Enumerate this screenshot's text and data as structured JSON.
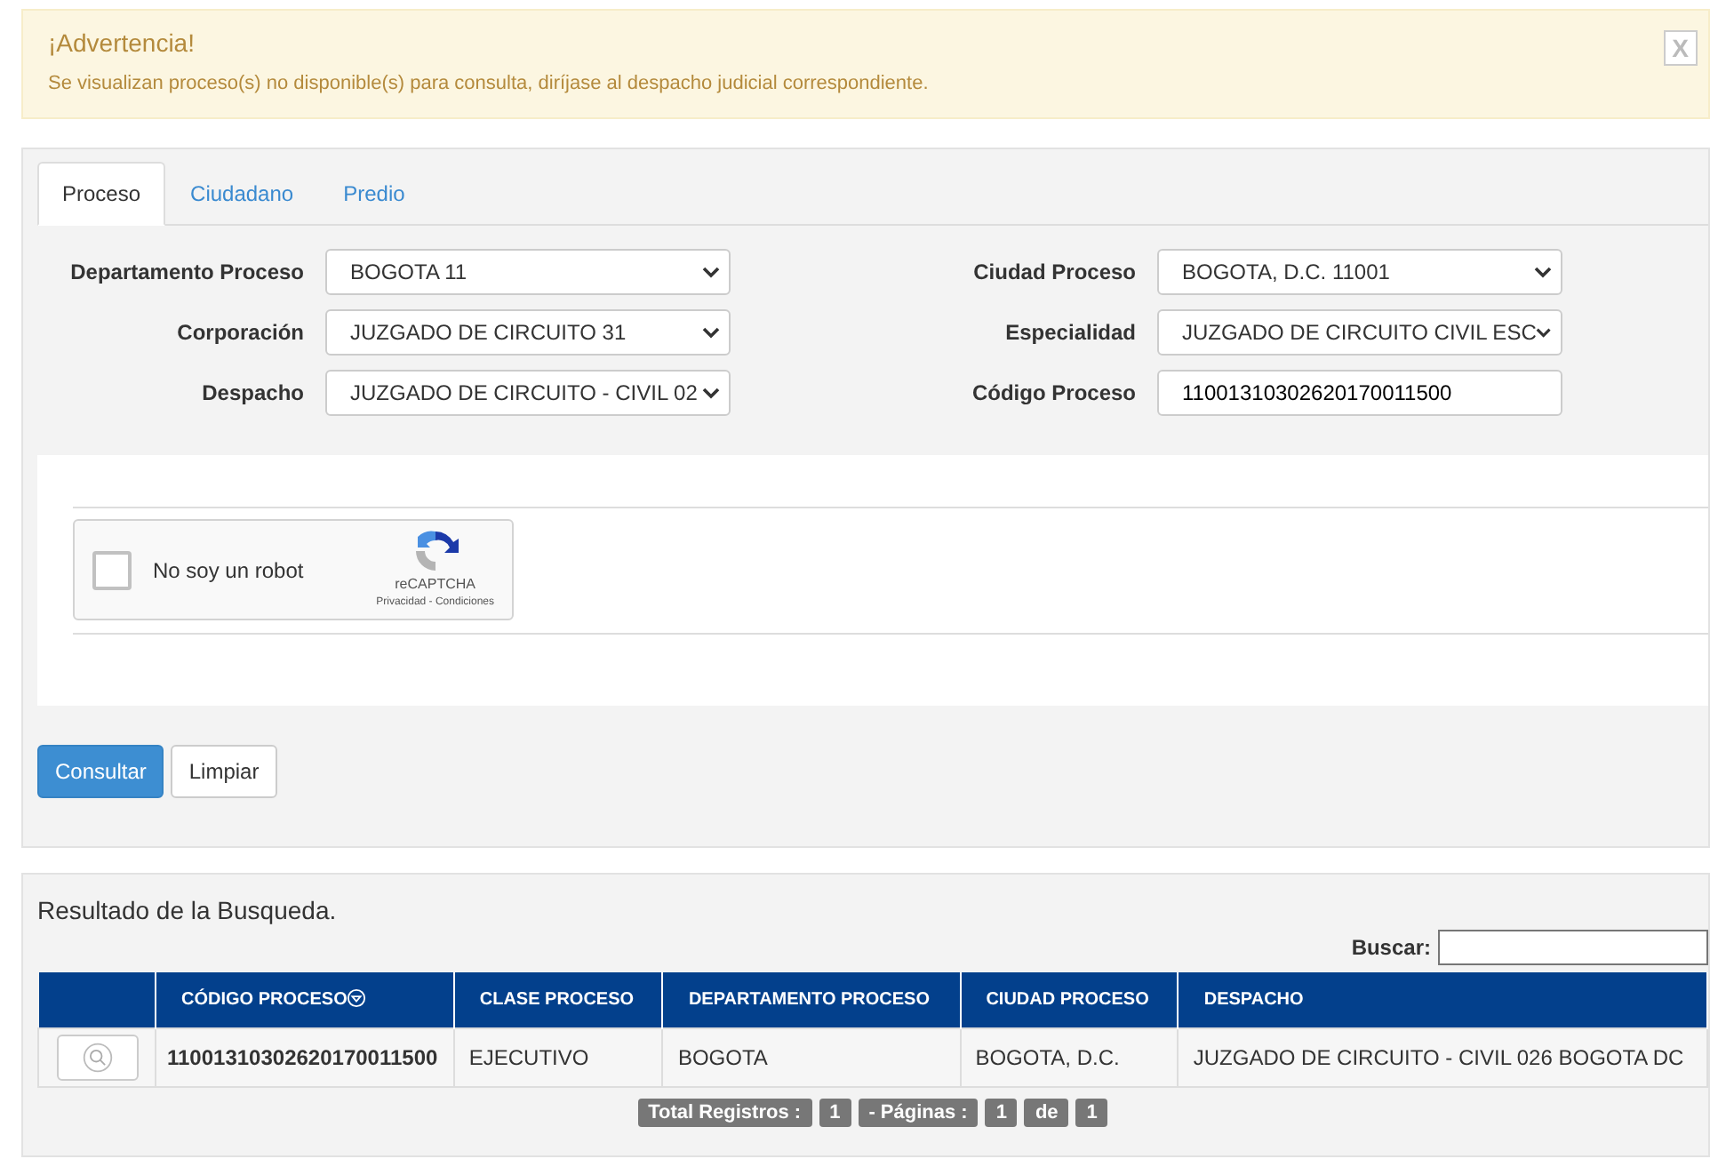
{
  "alert": {
    "title": "¡Advertencia!",
    "message": "Se visualizan proceso(s) no disponible(s) para consulta, diríjase al despacho judicial correspondiente.",
    "close": "X"
  },
  "tabs": [
    {
      "label": "Proceso",
      "selected": true
    },
    {
      "label": "Ciudadano",
      "selected": false
    },
    {
      "label": "Predio",
      "selected": false
    }
  ],
  "fields": [
    {
      "label": "Departamento Proceso",
      "kind": "select",
      "value": "BOGOTA 11"
    },
    {
      "label": "Ciudad Proceso",
      "kind": "select",
      "value": "BOGOTA, D.C. 11001"
    },
    {
      "label": "Corporación",
      "kind": "select",
      "value": "JUZGADO DE CIRCUITO 31"
    },
    {
      "label": "Especialidad",
      "kind": "select",
      "value": "JUZGADO DE CIRCUITO CIVIL ESC"
    },
    {
      "label": "Despacho",
      "kind": "select",
      "value": "JUZGADO DE CIRCUITO - CIVIL 02"
    },
    {
      "label": "Código Proceso",
      "kind": "input",
      "value": "11001310302620170011500"
    }
  ],
  "captcha": {
    "label": "No soy un robot",
    "checked": false,
    "brand": "reCAPTCHA",
    "links": "Privacidad - Condiciones"
  },
  "buttons": [
    {
      "label": "Consultar",
      "kind": "primary"
    },
    {
      "label": "Limpiar",
      "kind": "default"
    }
  ],
  "results": {
    "title": "Resultado de la Busqueda.",
    "search_label": "Buscar:",
    "columns": [
      "CÓDIGO PROCESO",
      "CLASE PROCESO",
      "DEPARTAMENTO PROCESO",
      "CIUDAD PROCESO",
      "DESPACHO"
    ],
    "rows": [
      [
        "11001310302620170011500",
        "EJECUTIVO",
        "BOGOTA",
        "BOGOTA, D.C.",
        "JUZGADO DE CIRCUITO - CIVIL 026 BOGOTA DC"
      ]
    ],
    "pagination": [
      "Total Registros :",
      "1",
      "- Páginas :",
      "1",
      "de",
      "1"
    ]
  }
}
